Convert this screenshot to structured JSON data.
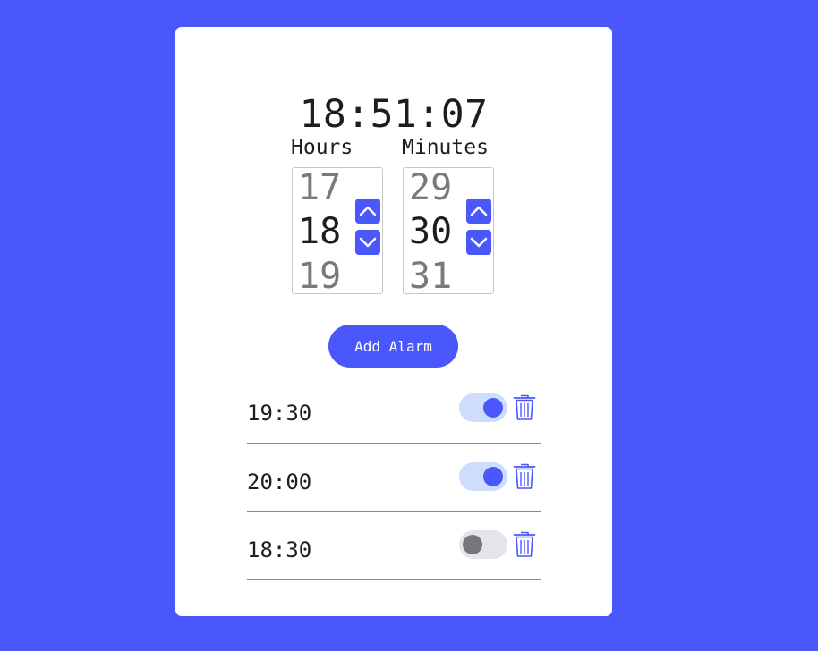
{
  "clock": {
    "time": "18:51:07"
  },
  "pickers": {
    "hours": {
      "label": "Hours",
      "prev": "17",
      "current": "18",
      "next": "19"
    },
    "minutes": {
      "label": "Minutes",
      "prev": "29",
      "current": "30",
      "next": "31"
    }
  },
  "add_button": {
    "label": "Add Alarm"
  },
  "alarms": [
    {
      "time": "19:30",
      "enabled": true
    },
    {
      "time": "20:00",
      "enabled": true
    },
    {
      "time": "18:30",
      "enabled": false
    }
  ],
  "colors": {
    "accent": "#4a57fc",
    "toggle_on_track": "#cfddfc",
    "toggle_off_track": "#e6e3ea",
    "toggle_off_knob": "#77757e"
  },
  "icons": {
    "up": "chevron-up-icon",
    "down": "chevron-down-icon",
    "delete": "trash-icon"
  }
}
